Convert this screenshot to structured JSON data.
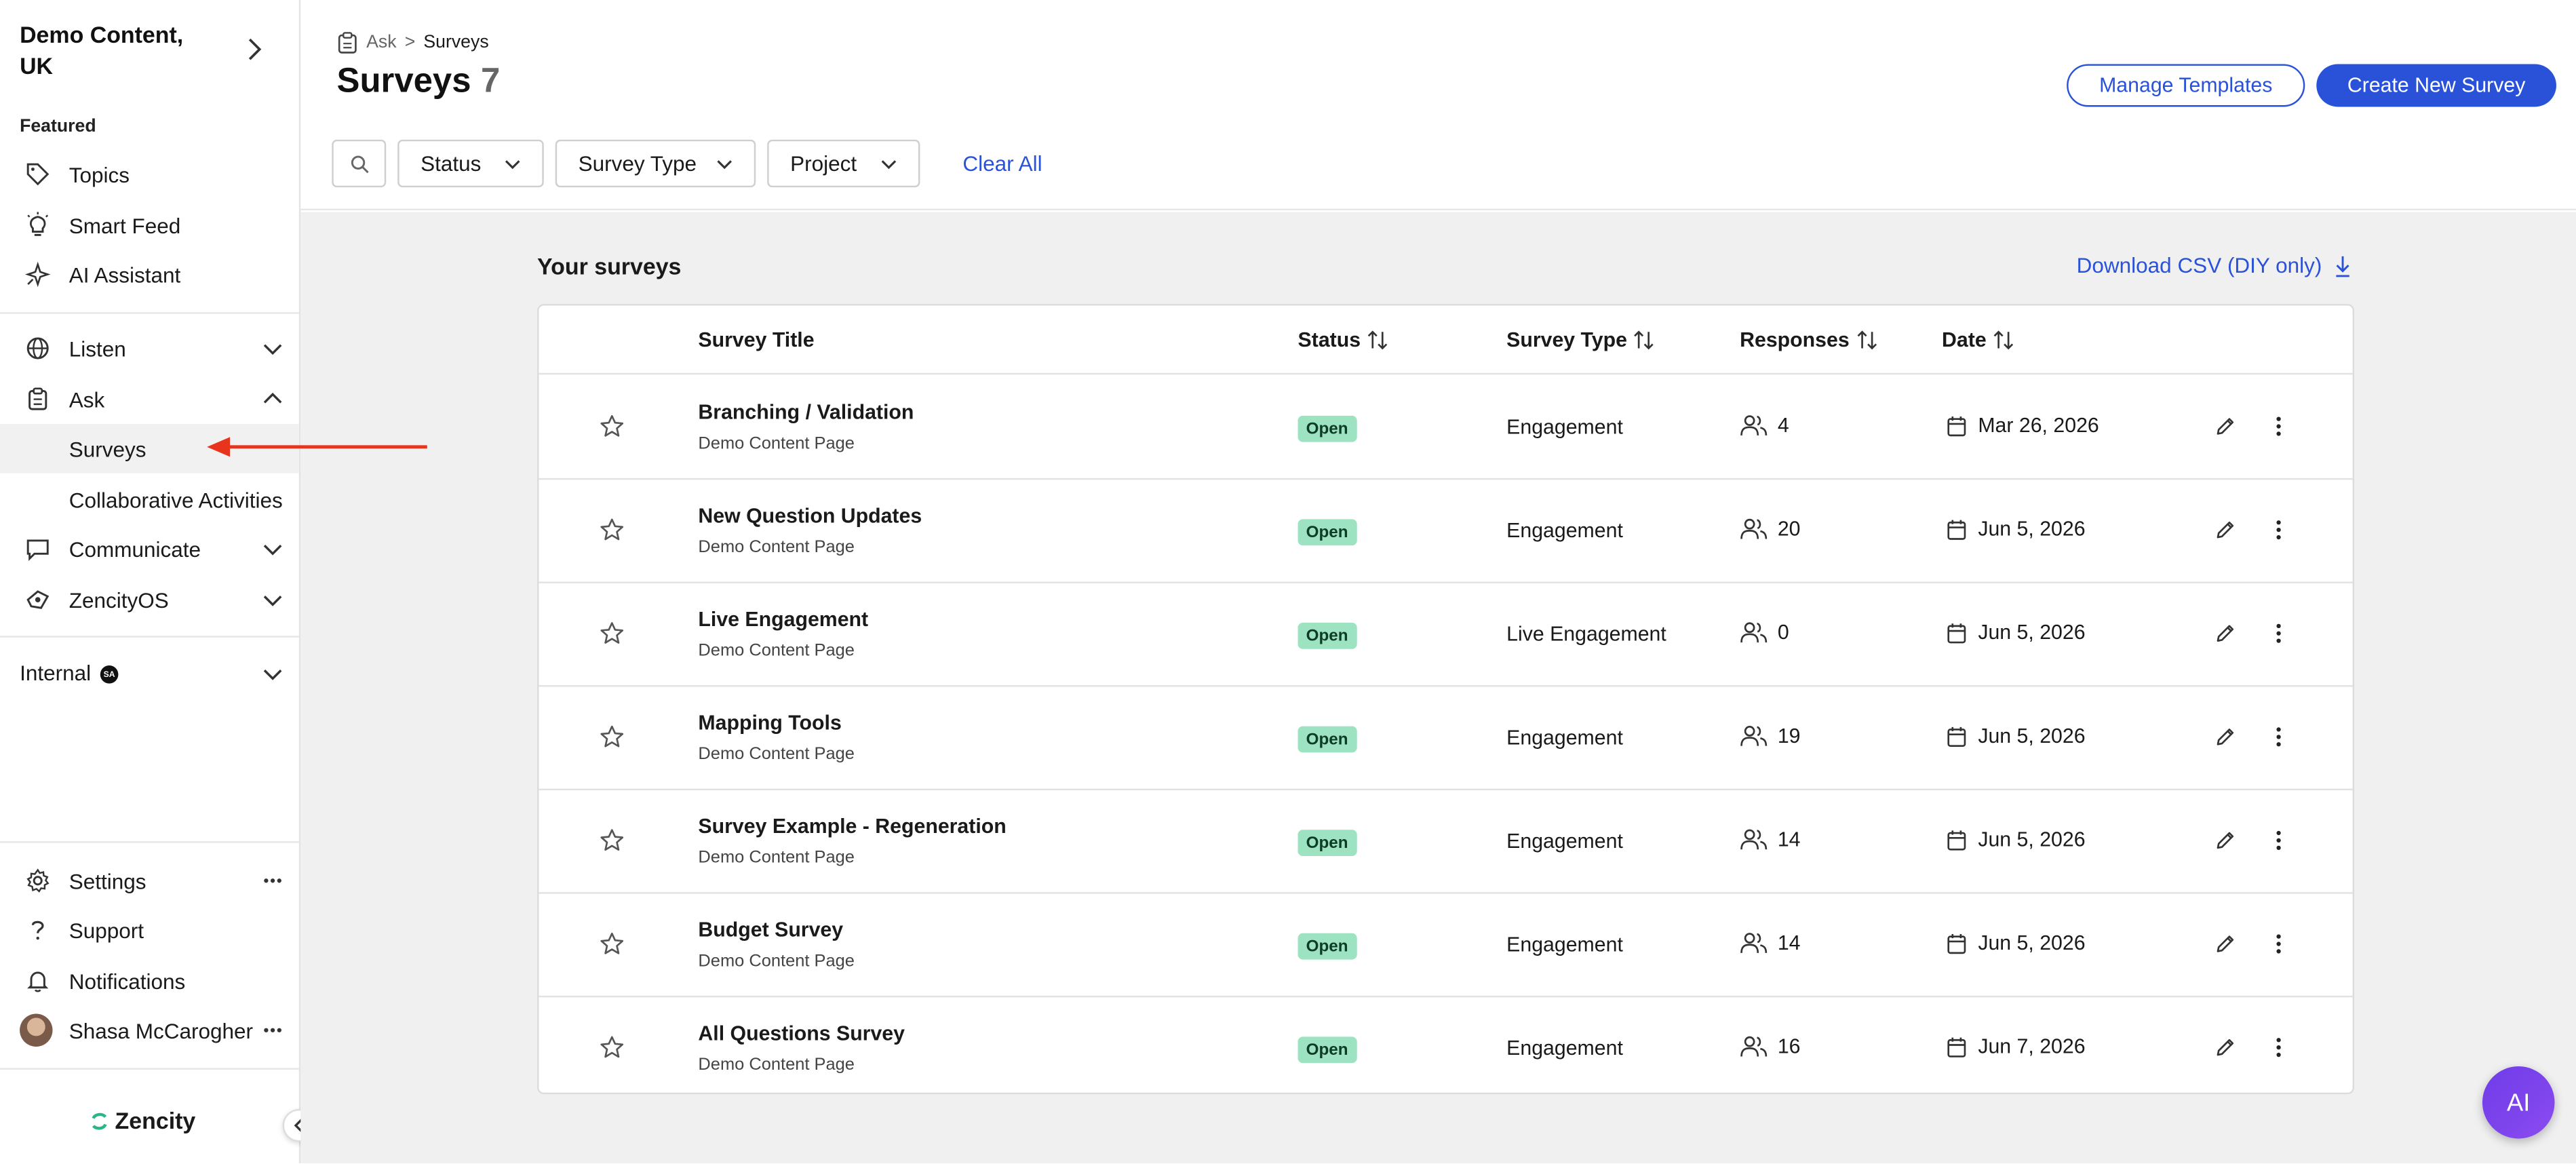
{
  "sidebar": {
    "org_name": "Demo Content, UK",
    "featured_label": "Featured",
    "items": [
      {
        "label": "Topics",
        "icon": "tag-icon"
      },
      {
        "label": "Smart Feed",
        "icon": "lightbulb-icon"
      },
      {
        "label": "AI Assistant",
        "icon": "sparkle-icon"
      },
      {
        "label": "Listen",
        "icon": "globe-icon"
      },
      {
        "label": "Ask",
        "icon": "clipboard-icon"
      },
      {
        "label": "Surveys"
      },
      {
        "label": "Collaborative Activities"
      },
      {
        "label": "Communicate",
        "icon": "chat-icon"
      },
      {
        "label": "ZencityOS",
        "icon": "zencityos-icon"
      }
    ],
    "internal_label": "Internal",
    "internal_badge": "SA",
    "bottom": [
      {
        "label": "Settings",
        "icon": "gear-icon"
      },
      {
        "label": "Support",
        "icon": "question-icon"
      },
      {
        "label": "Notifications",
        "icon": "bell-icon"
      },
      {
        "label": "Shasa McCarogher",
        "icon": "avatar"
      }
    ],
    "logo_text": "Zencity"
  },
  "header": {
    "breadcrumb_parent": "Ask",
    "breadcrumb_separator": ">",
    "breadcrumb_current": "Surveys",
    "title": "Surveys",
    "count": "7",
    "manage_templates": "Manage Templates",
    "create_new": "Create New Survey",
    "filters": {
      "status": "Status",
      "survey_type": "Survey Type",
      "project": "Project",
      "clear_all": "Clear All"
    }
  },
  "main": {
    "section_title": "Your surveys",
    "download_csv": "Download CSV (DIY only)",
    "columns": {
      "title": "Survey Title",
      "status": "Status",
      "type": "Survey Type",
      "responses": "Responses",
      "date": "Date"
    },
    "rows": [
      {
        "title": "Branching / Validation",
        "subtitle": "Demo Content Page",
        "status": "Open",
        "type": "Engagement",
        "responses": "4",
        "date": "Mar 26, 2026"
      },
      {
        "title": "New Question Updates",
        "subtitle": "Demo Content Page",
        "status": "Open",
        "type": "Engagement",
        "responses": "20",
        "date": "Jun 5, 2026"
      },
      {
        "title": "Live Engagement",
        "subtitle": "Demo Content Page",
        "status": "Open",
        "type": "Live Engagement",
        "responses": "0",
        "date": "Jun 5, 2026"
      },
      {
        "title": "Mapping Tools",
        "subtitle": "Demo Content Page",
        "status": "Open",
        "type": "Engagement",
        "responses": "19",
        "date": "Jun 5, 2026"
      },
      {
        "title": "Survey Example - Regeneration",
        "subtitle": "Demo Content Page",
        "status": "Open",
        "type": "Engagement",
        "responses": "14",
        "date": "Jun 5, 2026"
      },
      {
        "title": "Budget Survey",
        "subtitle": "Demo Content Page",
        "status": "Open",
        "type": "Engagement",
        "responses": "14",
        "date": "Jun 5, 2026"
      },
      {
        "title": "All Questions Survey",
        "subtitle": "Demo Content Page",
        "status": "Open",
        "type": "Engagement",
        "responses": "16",
        "date": "Jun 7, 2026"
      }
    ]
  },
  "ai_button": "AI",
  "colors": {
    "accent": "#2a52d8",
    "open_badge_bg": "#9de3c2",
    "annotation_arrow": "#e8341c",
    "ai_button": "#7a42ec",
    "logo_mark": "#2bb58a"
  }
}
